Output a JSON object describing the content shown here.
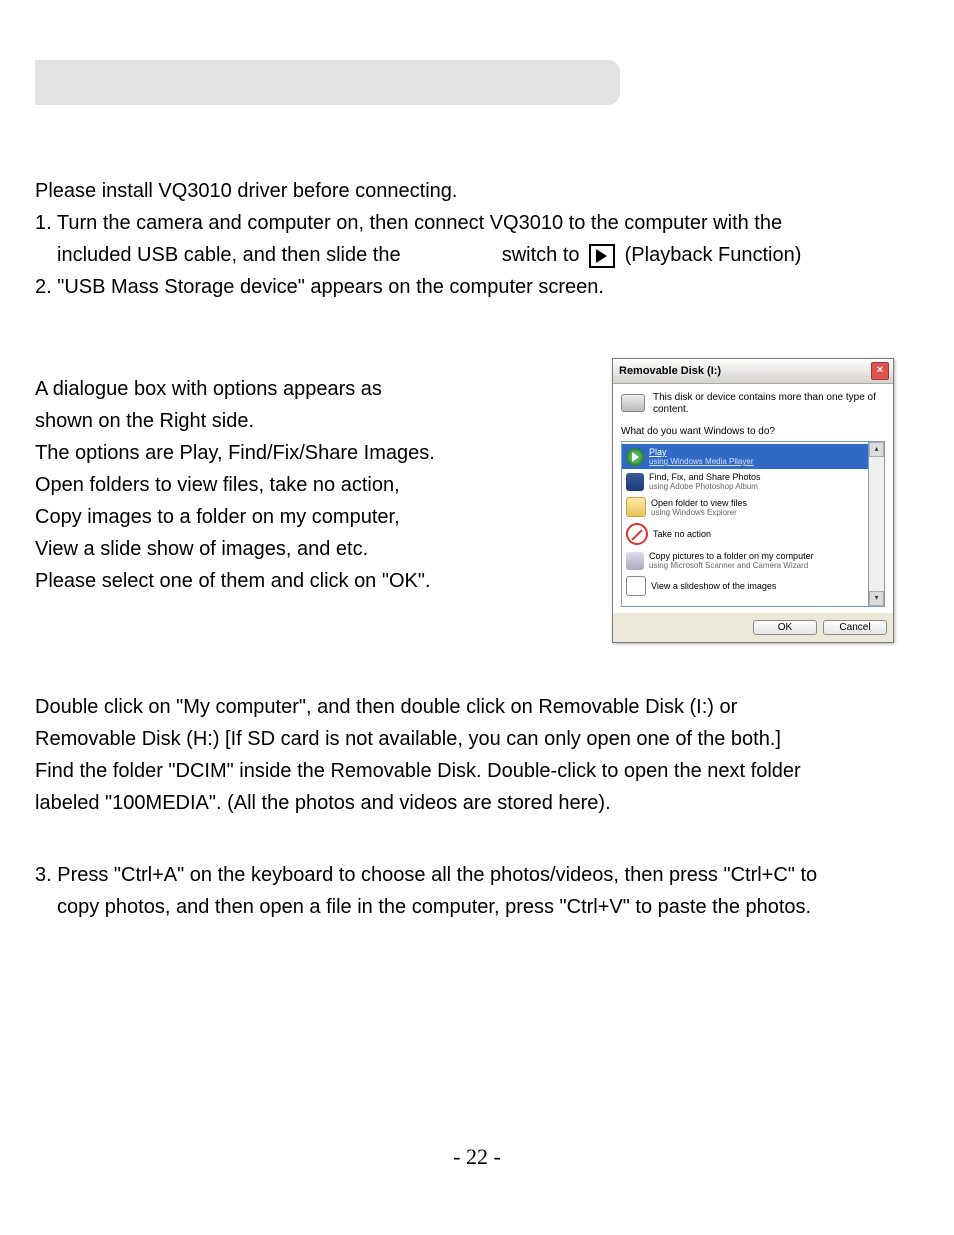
{
  "intro": "Please install VQ3010 driver before connecting.",
  "step1a": "1. Turn the camera and computer on, then connect VQ3010 to the computer with the",
  "step1b_left": "included USB cable, and then slide the",
  "step1b_mid": "switch to",
  "step1b_right": "(Playback Function)",
  "step2": "2. \"USB Mass Storage device\" appears on the computer screen.",
  "left": {
    "l1": "A dialogue box with options appears as",
    "l2": "shown on the Right side.",
    "l3": "The options are Play, Find/Fix/Share Images.",
    "l4": "Open folders to view files, take no action,",
    "l5": "Copy images to a folder on my computer,",
    "l6": "View a slide show of images, and etc.",
    "l7": "Please select one of them and click on \"OK\"."
  },
  "dialog": {
    "title": "Removable Disk (I:)",
    "intro": "This disk or device contains more than one type of content.",
    "prompt": "What do you want Windows to do?",
    "items": [
      {
        "title": "Play",
        "sub": "using Windows Media Pllayer"
      },
      {
        "title": "Find, Fix, and Share Photos",
        "sub": "using Adobe Photoshop Album"
      },
      {
        "title": "Open folder to view files",
        "sub": "using Windows Explorer"
      },
      {
        "title": "Take no action",
        "sub": ""
      },
      {
        "title": "Copy pictures to a folder on my computer",
        "sub": "using Microsoft Scanner and Camera Wizard"
      },
      {
        "title": "View a slideshow of the images",
        "sub": ""
      }
    ],
    "ok": "OK",
    "cancel": "Cancel"
  },
  "para2a": "Double click on \"My computer\", and then double click on Removable Disk (I:) or",
  "para2b": "Removable Disk (H:) [If SD card is not available, you can only open one of the both.]",
  "para2c": "Find the folder \"DCIM\" inside the Removable Disk. Double-click to open the next folder",
  "para2d": "labeled \"100MEDIA\". (All the photos and videos are stored here).",
  "step3a": "3. Press \"Ctrl+A\" on the keyboard to choose all the photos/videos, then press \"Ctrl+C\" to",
  "step3b": "copy photos, and then open a file in the computer, press \"Ctrl+V\" to paste the photos.",
  "page_no": "- 22 -"
}
